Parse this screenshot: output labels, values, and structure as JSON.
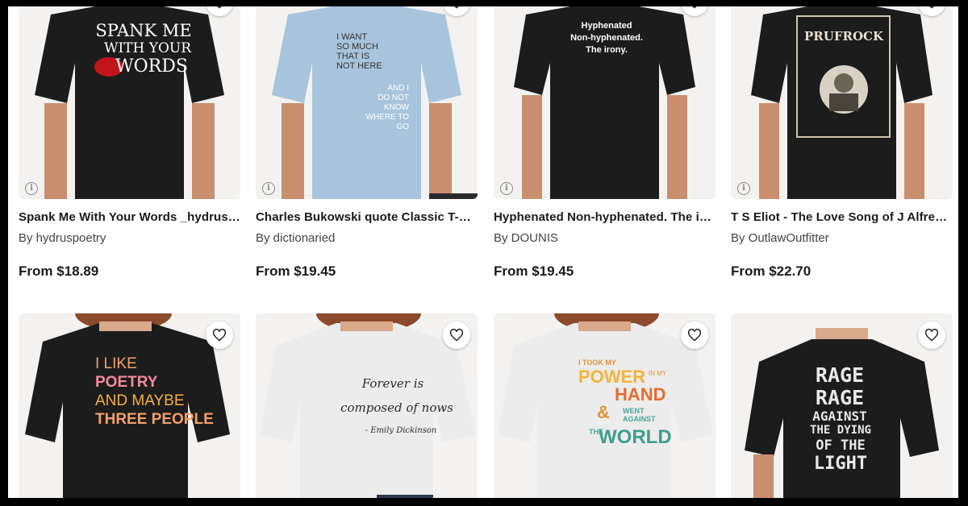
{
  "products": [
    {
      "title": "Spank Me With Your Words _hydruspoetry Classic T-Shirt",
      "artist": "By hydruspoetry",
      "price": "From $18.89",
      "shirt_color": "#1c1c1c",
      "print_lines": [
        "SPANK ME",
        "WITH YOUR",
        "WORDS"
      ]
    },
    {
      "title": "Charles Bukowski quote Classic T-Shirt",
      "artist": "By dictionaried",
      "price": "From $19.45",
      "shirt_color": "#a8c4dc",
      "print_lines": [
        "I WANT",
        "SO MUCH",
        "THAT IS",
        "NOT HERE",
        "AND I",
        "DO NOT",
        "KNOW",
        "WHERE TO",
        "GO"
      ]
    },
    {
      "title": "Hyphenated Non-hyphenated. The irony. Classic T-Shirt",
      "artist": "By DOUNIS",
      "price": "From $19.45",
      "shirt_color": "#1c1c1c",
      "print_lines": [
        "Hyphenated",
        "Non-hyphenated.",
        "The irony."
      ]
    },
    {
      "title": "T S Eliot - The Love Song of J Alfred Prufrock Classic T-Shirt",
      "artist": "By OutlawOutfitter",
      "price": "From $22.70",
      "shirt_color": "#1c1c1c",
      "print_lines": [
        "PRUFROCK"
      ]
    },
    {
      "title": "",
      "artist": "",
      "price": "",
      "shirt_color": "#1c1c1c",
      "print_lines": [
        "I LIKE",
        "POETRY",
        "AND MAYBE",
        "THREE PEOPLE"
      ]
    },
    {
      "title": "",
      "artist": "",
      "price": "",
      "shirt_color": "#ececec",
      "print_lines": [
        "Forever is",
        "composed of nows",
        "- Emily Dickinson"
      ]
    },
    {
      "title": "",
      "artist": "",
      "price": "",
      "shirt_color": "#ececec",
      "print_lines": [
        "I TOOK MY",
        "POWER",
        "IN MY",
        "HAND",
        "&",
        "WENT",
        "AGAINST",
        "THE",
        "WORLD"
      ]
    },
    {
      "title": "",
      "artist": "",
      "price": "",
      "shirt_color": "#1c1c1c",
      "print_lines": [
        "RAGE",
        "RAGE",
        "AGAINST",
        "THE DYING",
        "OF THE",
        "LIGHT"
      ]
    }
  ],
  "icons": {
    "info": "info-icon",
    "favorite": "heart-icon"
  }
}
